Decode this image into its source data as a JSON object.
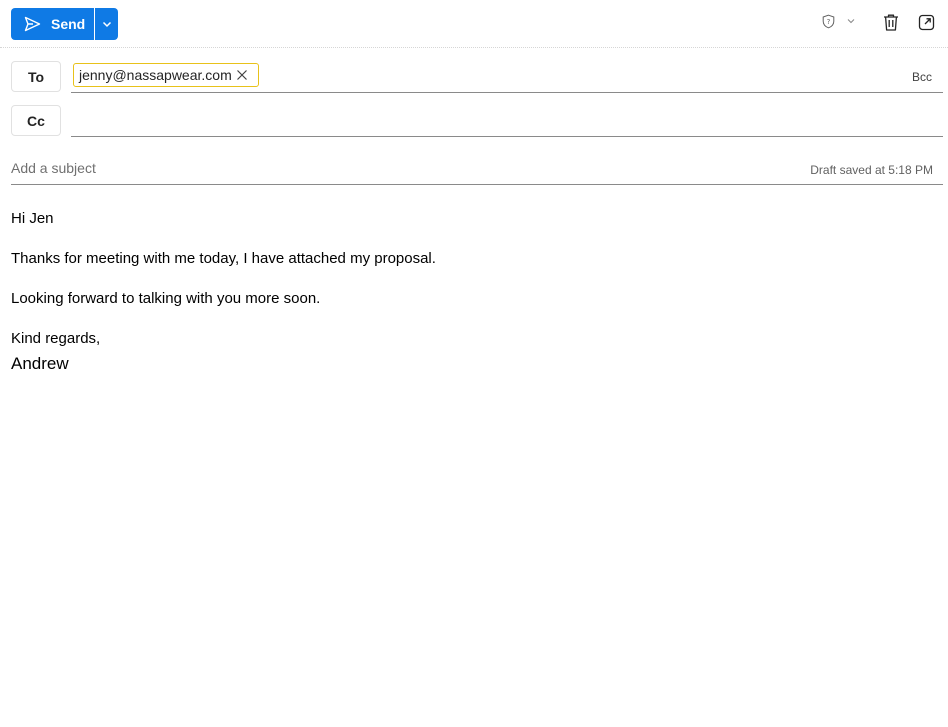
{
  "toolbar": {
    "send_label": "Send",
    "icons": [
      "send-icon",
      "chevron-down-icon",
      "sensitivity-icon",
      "trash-icon",
      "popout-icon"
    ]
  },
  "recipients": {
    "to_label": "To",
    "cc_label": "Cc",
    "bcc_label": "Bcc",
    "to_chips": [
      "jenny@nassapwear.com"
    ]
  },
  "subject": {
    "placeholder": "Add a subject",
    "value": "",
    "draft_status": "Draft saved at 5:18 PM"
  },
  "body": {
    "greeting": "Hi Jen",
    "line1": "Thanks for meeting with me today, I have attached my proposal.",
    "line2": "Looking forward to talking with you more soon.",
    "closing": "Kind regards,",
    "signature": "Andrew"
  },
  "colors": {
    "accent": "#0f7ae5",
    "chip_border": "#e8c21a"
  }
}
